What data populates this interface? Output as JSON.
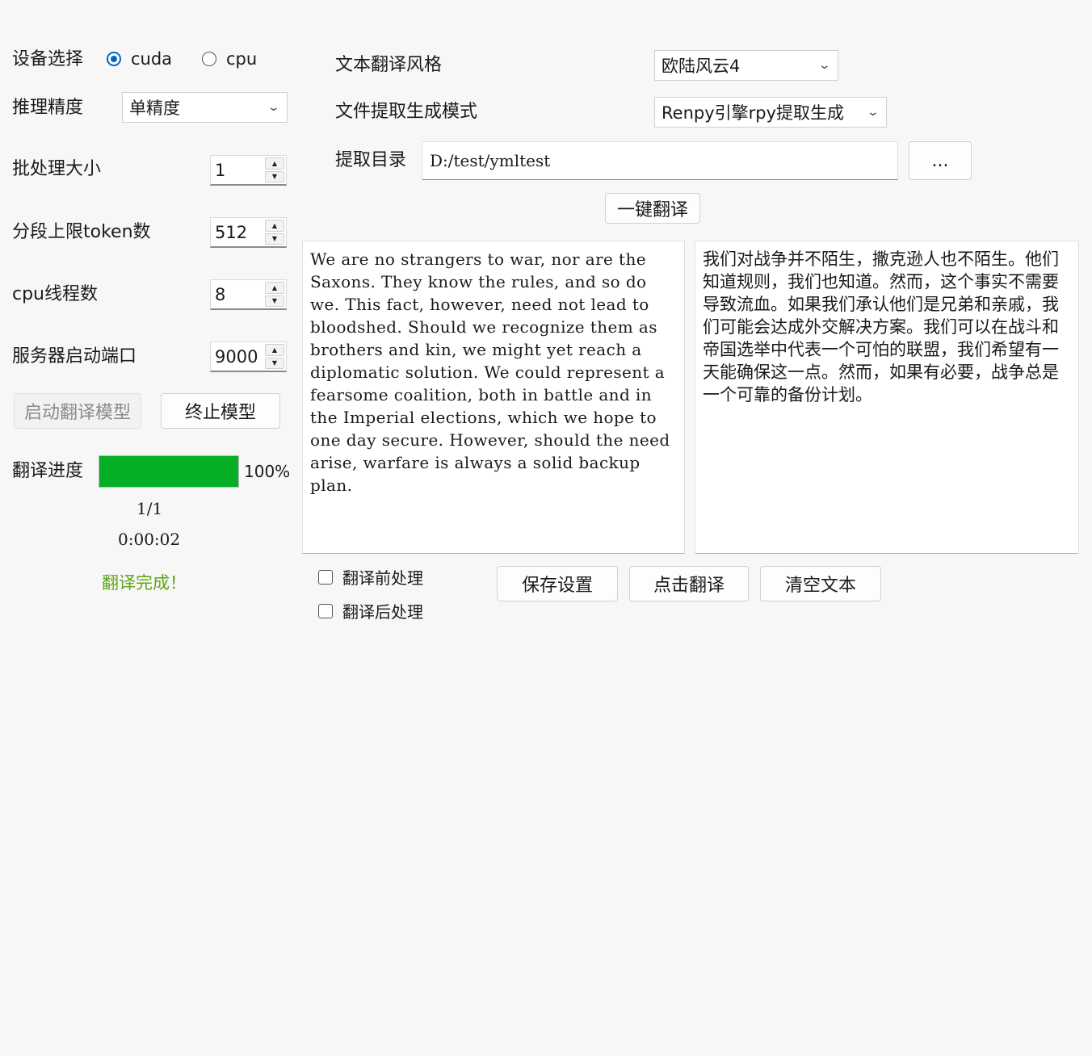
{
  "left": {
    "device": {
      "label": "设备选择",
      "options": [
        {
          "label": "cuda",
          "selected": true
        },
        {
          "label": "cpu",
          "selected": false
        }
      ]
    },
    "precision": {
      "label": "推理精度",
      "value": "单精度"
    },
    "batch_size": {
      "label": "批处理大小",
      "value": "1"
    },
    "token_limit": {
      "label": "分段上限token数",
      "value": "512"
    },
    "cpu_threads": {
      "label": "cpu线程数",
      "value": "8"
    },
    "server_port": {
      "label": "服务器启动端口",
      "value": "9000"
    },
    "start_model_label": "启动翻译模型",
    "stop_model_label": "终止模型",
    "progress": {
      "label": "翻译进度",
      "percent_text": "100%",
      "percent": 100,
      "count": "1/1",
      "elapsed": "0:00:02",
      "status": "翻译完成！",
      "status_color": "#5fa516",
      "bar_color": "#06b025"
    }
  },
  "right": {
    "style": {
      "label": "文本翻译风格",
      "value": "欧陆风云4"
    },
    "extract_mode": {
      "label": "文件提取生成模式",
      "value": "Renpy引擎rpy提取生成"
    },
    "extract_dir": {
      "label": "提取目录",
      "value": "D:/test/ymltest",
      "browse_label": "..."
    },
    "one_click_label": "一键翻译",
    "source_text": "We are no strangers to war, nor are the Saxons. They know the rules, and so do we. This fact, however, need not lead to bloodshed. Should we recognize them as brothers and kin, we might yet reach a diplomatic solution. We could represent a fearsome coalition, both in battle and in the Imperial elections, which we hope to one day secure. However, should the need arise, warfare is always a solid backup plan.",
    "target_text": "我们对战争并不陌生，撒克逊人也不陌生。他们知道规则，我们也知道。然而，这个事实不需要导致流血。如果我们承认他们是兄弟和亲戚，我们可能会达成外交解决方案。我们可以在战斗和帝国选举中代表一个可怕的联盟，我们希望有一天能确保这一点。然而，如果有必要，战争总是一个可靠的备份计划。",
    "pre_process_label": "翻译前处理",
    "post_process_label": "翻译后处理",
    "save_label": "保存设置",
    "translate_label": "点击翻译",
    "clear_label": "清空文本"
  }
}
